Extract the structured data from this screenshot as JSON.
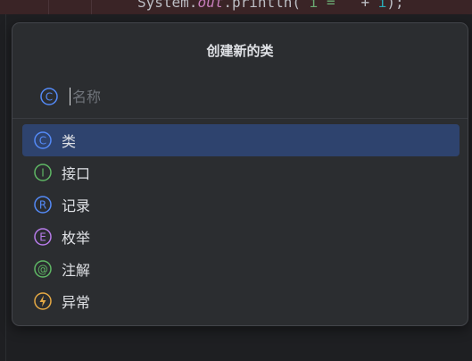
{
  "editor": {
    "code": {
      "prefix": "System.",
      "field": "out",
      "call": ".println( ",
      "str": "i = ",
      "op": "  + ",
      "num": "i",
      "suffix": ");"
    }
  },
  "dialog": {
    "title": "创建新的类",
    "search": {
      "value": "",
      "placeholder": "名称",
      "icon": "class-icon"
    },
    "items": [
      {
        "label": "类",
        "icon": "class-icon",
        "icon_letter": "C",
        "color": "#548af7",
        "selected": true
      },
      {
        "label": "接口",
        "icon": "interface-icon",
        "icon_letter": "I",
        "color": "#5fb865",
        "selected": false
      },
      {
        "label": "记录",
        "icon": "record-icon",
        "icon_letter": "R",
        "color": "#548af7",
        "selected": false
      },
      {
        "label": "枚举",
        "icon": "enum-icon",
        "icon_letter": "E",
        "color": "#b77bea",
        "selected": false
      },
      {
        "label": "注解",
        "icon": "annotation-icon",
        "icon_letter": "@",
        "color": "#5fb865",
        "selected": false
      },
      {
        "label": "异常",
        "icon": "exception-icon",
        "icon_letter": "⚡",
        "color": "#e5a944",
        "selected": false
      }
    ]
  },
  "colors": {
    "selection": "#2e436e",
    "popup_bg": "#2b2d30",
    "editor_bg": "#1e1f22"
  }
}
